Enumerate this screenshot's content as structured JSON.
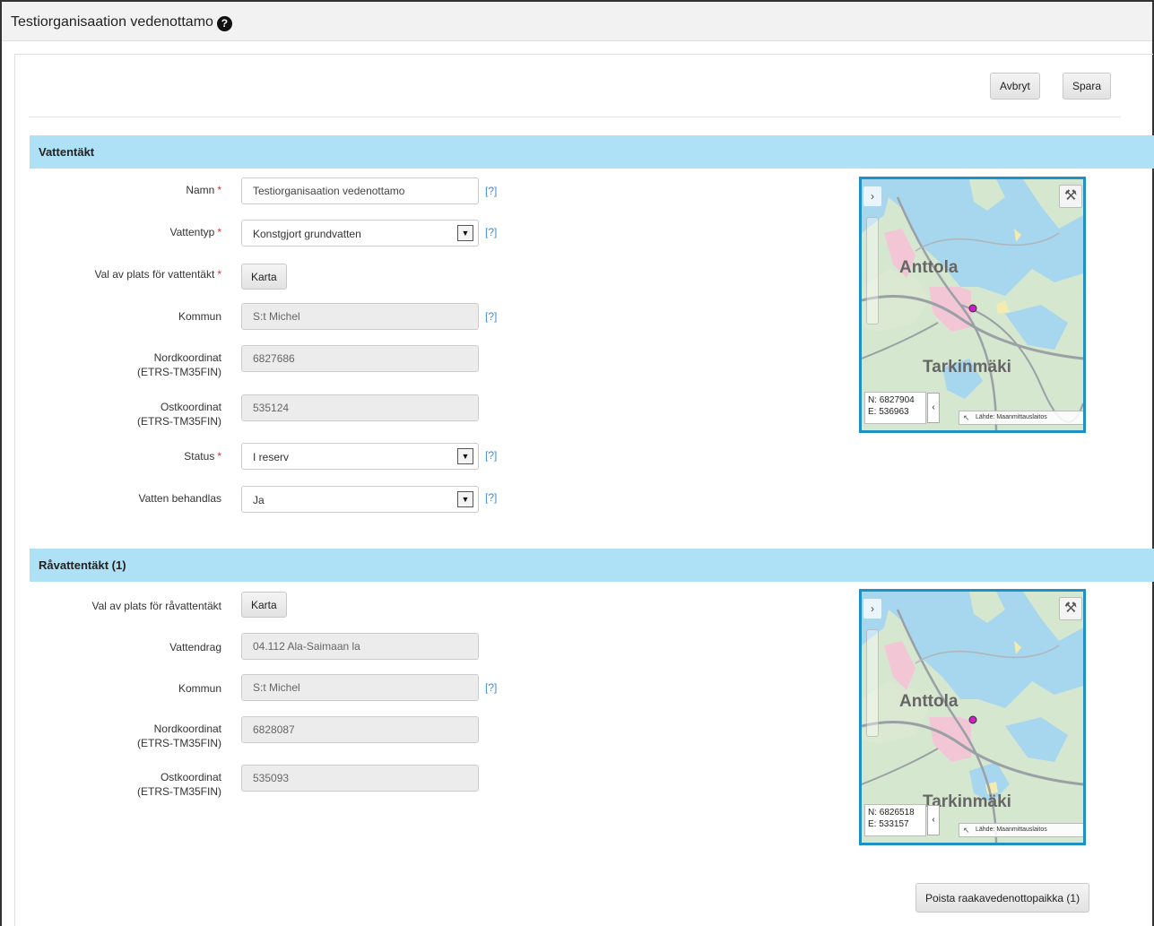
{
  "page": {
    "title": "Testiorganisaation vedenottamo",
    "help_glyph": "?"
  },
  "toolbar": {
    "cancel_label": "Avbryt",
    "save_label": "Spara"
  },
  "section1": {
    "title": "Vattentäkt",
    "fields": {
      "name_label": "Namn",
      "name_value": "Testiorganisaation vedenottamo",
      "watertype_label": "Vattentyp",
      "watertype_value": "Konstgjort grundvatten",
      "location_label": "Val av plats för vattentäkt",
      "map_button": "Karta",
      "municipality_label": "Kommun",
      "municipality_value": "S:t Michel",
      "north_label": "Nordkoordinat",
      "north_sub": "(ETRS-TM35FIN)",
      "north_value": "6827686",
      "east_label": "Ostkoordinat",
      "east_sub": "(ETRS-TM35FIN)",
      "east_value": "535124",
      "status_label": "Status",
      "status_value": "I reserv",
      "treated_label": "Vatten behandlas",
      "treated_value": "Ja"
    },
    "required_mark": "*",
    "help_hint": "[?]",
    "map": {
      "place1": "Anttola",
      "place2": "Tarkinmäki",
      "coord_n": "N: 6827904",
      "coord_e": "E: 536963",
      "attribution": "Lähde: Maanmittauslaitos",
      "expand_glyph": "›",
      "collapse_glyph": "‹",
      "corner_glyph": "↖",
      "tools_icon": "wrench-screwdriver-icon",
      "tools_glyph": "⚒",
      "marker_color": "#cc1fc8"
    }
  },
  "section2": {
    "title": "Råvattentäkt (1)",
    "fields": {
      "location_label": "Val av plats för råvattentäkt",
      "map_button": "Karta",
      "watercourse_label": "Vattendrag",
      "watercourse_value": "04.112 Ala-Saimaan la",
      "municipality_label": "Kommun",
      "municipality_value": "S:t Michel",
      "north_label": "Nordkoordinat",
      "north_sub": "(ETRS-TM35FIN)",
      "north_value": "6828087",
      "east_label": "Ostkoordinat",
      "east_sub": "(ETRS-TM35FIN)",
      "east_value": "535093"
    },
    "help_hint": "[?]",
    "map": {
      "place1": "Anttola",
      "place2": "Tarkinmäki",
      "coord_n": "N: 6826518",
      "coord_e": "E: 533157",
      "attribution": "Lähde: Maanmittauslaitos",
      "expand_glyph": "›",
      "collapse_glyph": "‹",
      "corner_glyph": "↖",
      "tools_glyph": "⚒"
    },
    "delete_button": "Poista raakavedenottopaikka (1)"
  },
  "colors": {
    "section_header": "#aee0f6",
    "link": "#3c8dd0",
    "required": "#dd3333",
    "map_border": "#1e90c6"
  }
}
